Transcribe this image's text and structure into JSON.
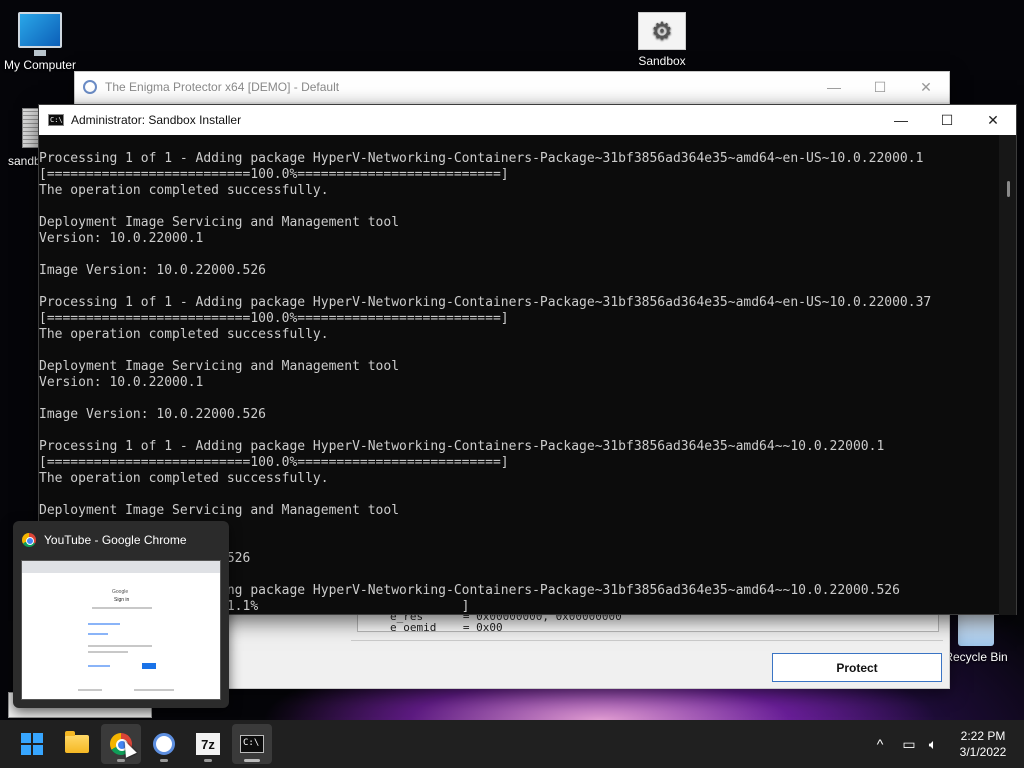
{
  "desktop": {
    "icons": {
      "my_computer": "My Computer",
      "sandbox": "Sandbox",
      "sandbox_partial": "sandb",
      "recycle_bin": "Recycle Bin"
    }
  },
  "enigma_window": {
    "title": "The Enigma Protector x64 [DEMO] - Default",
    "log_lines": [
      "e_res      = 0x00000000, 0x00000000",
      "e_oemid    = 0x00"
    ],
    "protect_button": "Protect"
  },
  "cmd_window": {
    "title": "Administrator: Sandbox Installer",
    "lines": [
      "Processing 1 of 1 - Adding package HyperV-Networking-Containers-Package~31bf3856ad364e35~amd64~en-US~10.0.22000.1",
      "[==========================100.0%==========================]",
      "The operation completed successfully.",
      "",
      "Deployment Image Servicing and Management tool",
      "Version: 10.0.22000.1",
      "",
      "Image Version: 10.0.22000.526",
      "",
      "Processing 1 of 1 - Adding package HyperV-Networking-Containers-Package~31bf3856ad364e35~amd64~en-US~10.0.22000.37",
      "[==========================100.0%==========================]",
      "The operation completed successfully.",
      "",
      "Deployment Image Servicing and Management tool",
      "Version: 10.0.22000.1",
      "",
      "Image Version: 10.0.22000.526",
      "",
      "Processing 1 of 1 - Adding package HyperV-Networking-Containers-Package~31bf3856ad364e35~amd64~~10.0.22000.1",
      "[==========================100.0%==========================]",
      "The operation completed successfully.",
      "",
      "Deployment Image Servicing and Management tool",
      "",
      "",
      "                       .526",
      "",
      "                       ing package HyperV-Networking-Containers-Package~31bf3856ad364e35~amd64~~10.0.22000.526",
      "                        1.1%                          ]"
    ]
  },
  "chrome_preview": {
    "title": "YouTube - Google Chrome",
    "shot_text": [
      "Google",
      "Sign in"
    ]
  },
  "taskbar": {
    "clock_time": "2:22 PM",
    "clock_date": "3/1/2022",
    "sevenz_label": "7z",
    "term_label": "C:\\"
  },
  "colors": {
    "accent": "#37a6ff",
    "taskbar": "#202020",
    "cmd_bg": "#0c0c0c",
    "cmd_text": "#cccccc"
  }
}
